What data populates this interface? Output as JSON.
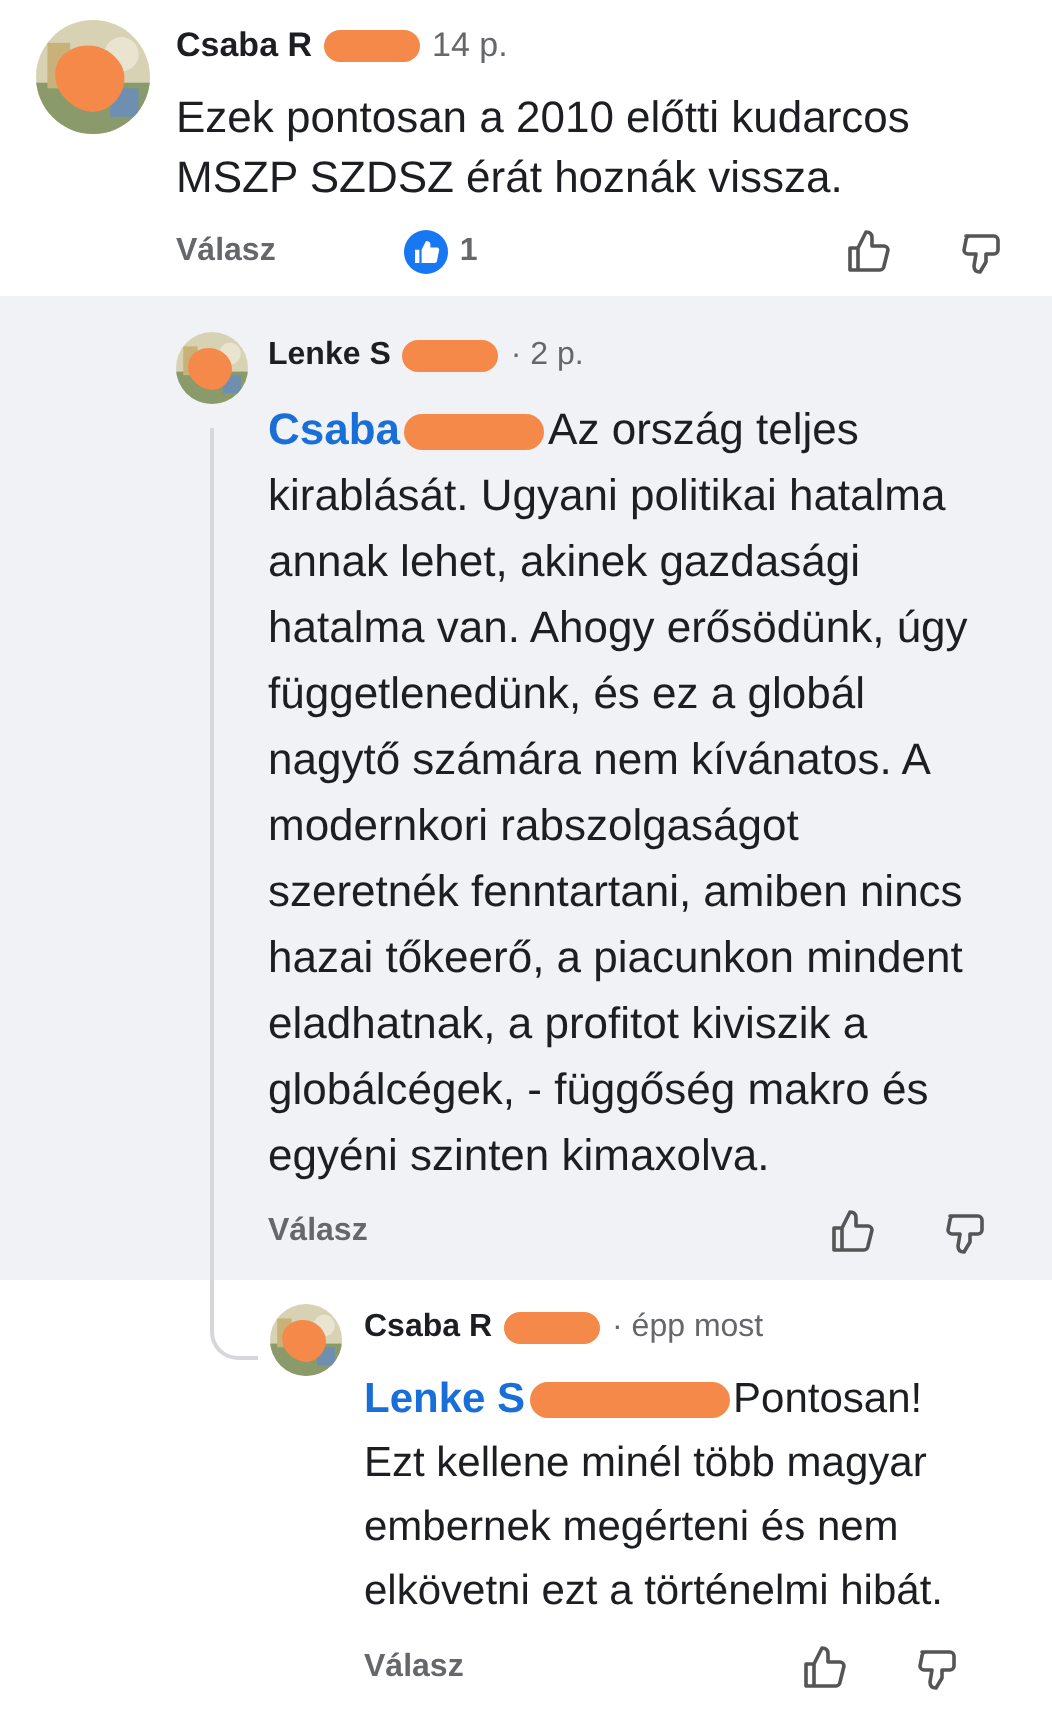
{
  "comments": [
    {
      "author": "Csaba R",
      "time": "14 p.",
      "text": "Ezek pontosan a 2010 előtti kudarcos MSZP SZDSZ érát hoznák vissza.",
      "highlighted": false,
      "reply_label": "Válasz",
      "reactions": "1",
      "children": [
        {
          "author": "Lenke S",
          "time": "· 2 p.",
          "mention": "Csaba",
          "text": "Az ország teljes kirablását. Ugyani politikai hatalma annak lehet, akinek gazdasági hatalma van. Ahogy erősödünk, úgy függetlenedünk, és ez a globál nagytő számára nem kívánatos. A modernkori rabszolgaságot szeretnék fenntartani, amiben nincs hazai tőkeerő, a piacunkon mindent eladhatnak, a profitot kiviszik a globálcégek, - függőség makro és egyéni szinten kimaxolva.",
          "highlighted": true,
          "reply_label": "Válasz",
          "children": [
            {
              "author": "Csaba R",
              "time": "· épp most",
              "mention": "Lenke S",
              "text": "Pontosan! Ezt kellene minél több magyar embernek megérteni és nem elkövetni ezt a történelmi hibát.",
              "highlighted": false,
              "reply_label": "Válasz"
            }
          ]
        }
      ]
    }
  ]
}
